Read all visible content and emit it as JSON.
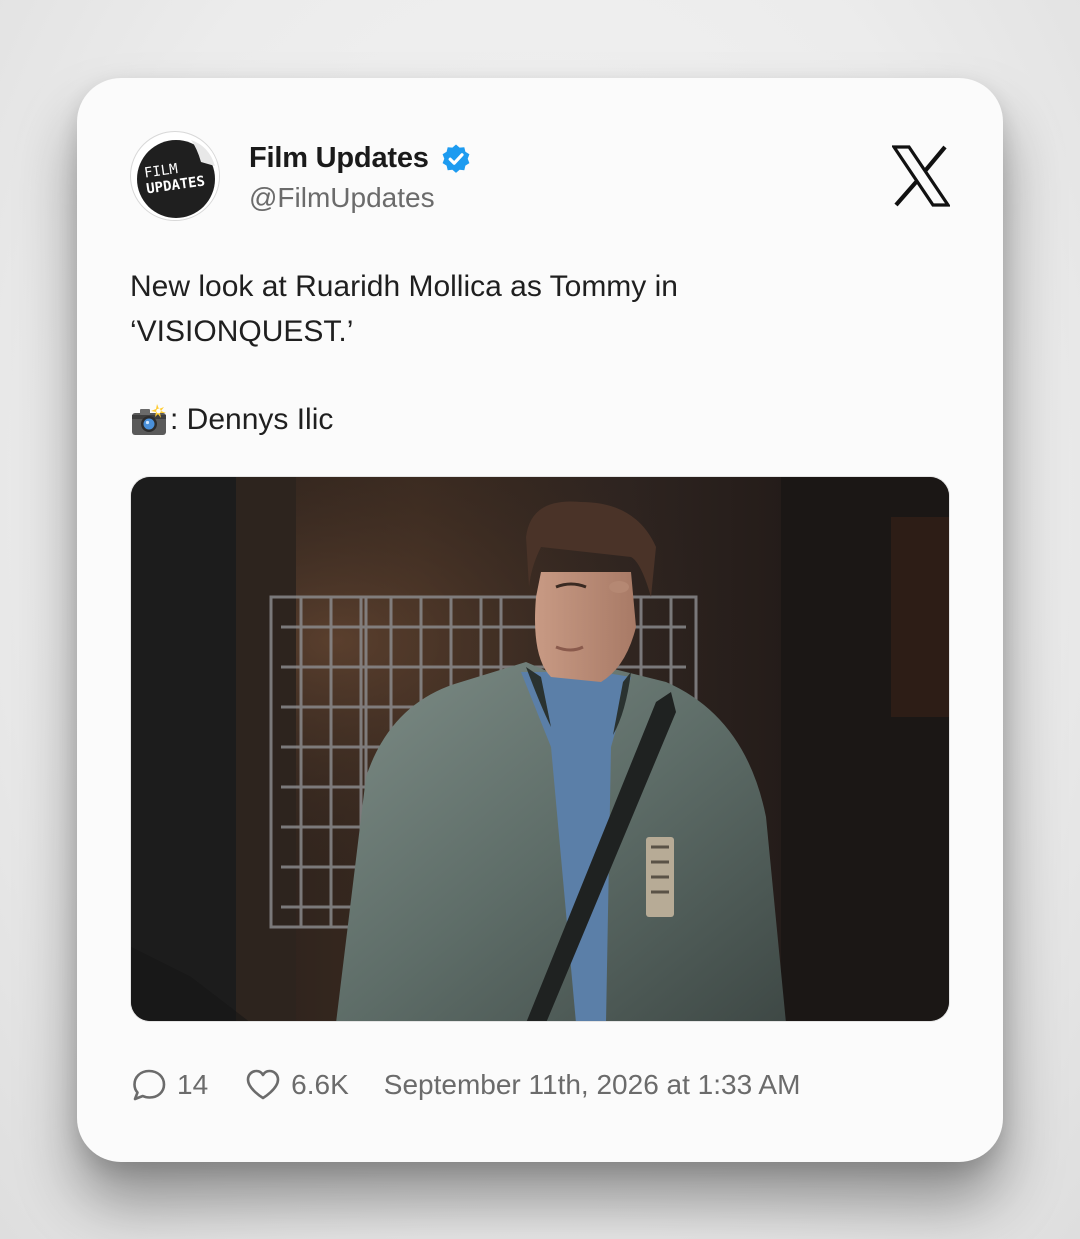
{
  "author": {
    "display_name": "Film Updates",
    "handle": "@FilmUpdates",
    "avatar_text_line1": "FILM",
    "avatar_text_line2": "UPDATES",
    "verified": true
  },
  "platform_icon": "x-logo-icon",
  "tweet": {
    "text_line1": "New look at Ruaridh Mollica as Tommy in",
    "text_line2": "‘VISIONQUEST.’",
    "credit_icon": "camera-flash-icon",
    "credit_text": ": Dennys Ilic"
  },
  "media": {
    "kind": "photo"
  },
  "footer": {
    "reply_icon": "reply-icon",
    "reply_count": "14",
    "like_icon": "heart-icon",
    "like_count": "6.6K",
    "timestamp": "September 11th, 2026 at 1:33 AM"
  },
  "colors": {
    "card_bg": "#fbfbfb",
    "verified_blue": "#1d9bf0",
    "text_primary": "#1f1f1f",
    "text_secondary": "#6b6b6b"
  }
}
